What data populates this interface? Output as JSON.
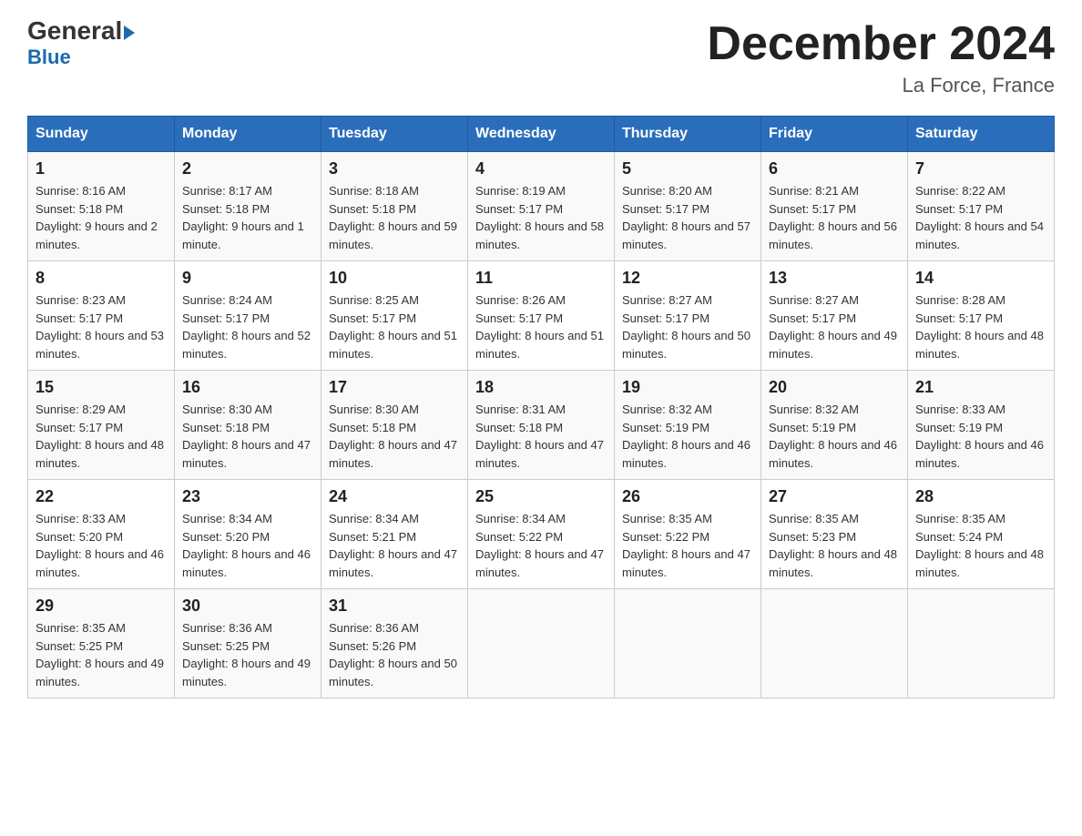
{
  "header": {
    "logo_general": "General",
    "logo_blue": "Blue",
    "month_title": "December 2024",
    "location": "La Force, France"
  },
  "days_of_week": [
    "Sunday",
    "Monday",
    "Tuesday",
    "Wednesday",
    "Thursday",
    "Friday",
    "Saturday"
  ],
  "weeks": [
    [
      {
        "day": "1",
        "sunrise": "8:16 AM",
        "sunset": "5:18 PM",
        "daylight": "9 hours and 2 minutes."
      },
      {
        "day": "2",
        "sunrise": "8:17 AM",
        "sunset": "5:18 PM",
        "daylight": "9 hours and 1 minute."
      },
      {
        "day": "3",
        "sunrise": "8:18 AM",
        "sunset": "5:18 PM",
        "daylight": "8 hours and 59 minutes."
      },
      {
        "day": "4",
        "sunrise": "8:19 AM",
        "sunset": "5:17 PM",
        "daylight": "8 hours and 58 minutes."
      },
      {
        "day": "5",
        "sunrise": "8:20 AM",
        "sunset": "5:17 PM",
        "daylight": "8 hours and 57 minutes."
      },
      {
        "day": "6",
        "sunrise": "8:21 AM",
        "sunset": "5:17 PM",
        "daylight": "8 hours and 56 minutes."
      },
      {
        "day": "7",
        "sunrise": "8:22 AM",
        "sunset": "5:17 PM",
        "daylight": "8 hours and 54 minutes."
      }
    ],
    [
      {
        "day": "8",
        "sunrise": "8:23 AM",
        "sunset": "5:17 PM",
        "daylight": "8 hours and 53 minutes."
      },
      {
        "day": "9",
        "sunrise": "8:24 AM",
        "sunset": "5:17 PM",
        "daylight": "8 hours and 52 minutes."
      },
      {
        "day": "10",
        "sunrise": "8:25 AM",
        "sunset": "5:17 PM",
        "daylight": "8 hours and 51 minutes."
      },
      {
        "day": "11",
        "sunrise": "8:26 AM",
        "sunset": "5:17 PM",
        "daylight": "8 hours and 51 minutes."
      },
      {
        "day": "12",
        "sunrise": "8:27 AM",
        "sunset": "5:17 PM",
        "daylight": "8 hours and 50 minutes."
      },
      {
        "day": "13",
        "sunrise": "8:27 AM",
        "sunset": "5:17 PM",
        "daylight": "8 hours and 49 minutes."
      },
      {
        "day": "14",
        "sunrise": "8:28 AM",
        "sunset": "5:17 PM",
        "daylight": "8 hours and 48 minutes."
      }
    ],
    [
      {
        "day": "15",
        "sunrise": "8:29 AM",
        "sunset": "5:17 PM",
        "daylight": "8 hours and 48 minutes."
      },
      {
        "day": "16",
        "sunrise": "8:30 AM",
        "sunset": "5:18 PM",
        "daylight": "8 hours and 47 minutes."
      },
      {
        "day": "17",
        "sunrise": "8:30 AM",
        "sunset": "5:18 PM",
        "daylight": "8 hours and 47 minutes."
      },
      {
        "day": "18",
        "sunrise": "8:31 AM",
        "sunset": "5:18 PM",
        "daylight": "8 hours and 47 minutes."
      },
      {
        "day": "19",
        "sunrise": "8:32 AM",
        "sunset": "5:19 PM",
        "daylight": "8 hours and 46 minutes."
      },
      {
        "day": "20",
        "sunrise": "8:32 AM",
        "sunset": "5:19 PM",
        "daylight": "8 hours and 46 minutes."
      },
      {
        "day": "21",
        "sunrise": "8:33 AM",
        "sunset": "5:19 PM",
        "daylight": "8 hours and 46 minutes."
      }
    ],
    [
      {
        "day": "22",
        "sunrise": "8:33 AM",
        "sunset": "5:20 PM",
        "daylight": "8 hours and 46 minutes."
      },
      {
        "day": "23",
        "sunrise": "8:34 AM",
        "sunset": "5:20 PM",
        "daylight": "8 hours and 46 minutes."
      },
      {
        "day": "24",
        "sunrise": "8:34 AM",
        "sunset": "5:21 PM",
        "daylight": "8 hours and 47 minutes."
      },
      {
        "day": "25",
        "sunrise": "8:34 AM",
        "sunset": "5:22 PM",
        "daylight": "8 hours and 47 minutes."
      },
      {
        "day": "26",
        "sunrise": "8:35 AM",
        "sunset": "5:22 PM",
        "daylight": "8 hours and 47 minutes."
      },
      {
        "day": "27",
        "sunrise": "8:35 AM",
        "sunset": "5:23 PM",
        "daylight": "8 hours and 48 minutes."
      },
      {
        "day": "28",
        "sunrise": "8:35 AM",
        "sunset": "5:24 PM",
        "daylight": "8 hours and 48 minutes."
      }
    ],
    [
      {
        "day": "29",
        "sunrise": "8:35 AM",
        "sunset": "5:25 PM",
        "daylight": "8 hours and 49 minutes."
      },
      {
        "day": "30",
        "sunrise": "8:36 AM",
        "sunset": "5:25 PM",
        "daylight": "8 hours and 49 minutes."
      },
      {
        "day": "31",
        "sunrise": "8:36 AM",
        "sunset": "5:26 PM",
        "daylight": "8 hours and 50 minutes."
      },
      null,
      null,
      null,
      null
    ]
  ],
  "labels": {
    "sunrise": "Sunrise:",
    "sunset": "Sunset:",
    "daylight": "Daylight:"
  }
}
